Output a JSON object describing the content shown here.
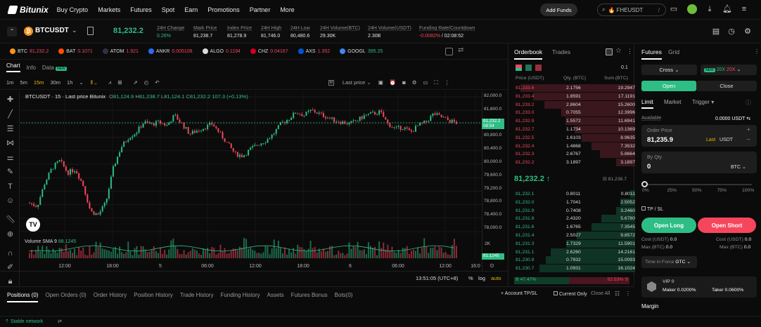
{
  "nav": {
    "brand": "Bitunix",
    "items": [
      "Buy Crypto",
      "Markets",
      "Futures",
      "Spot",
      "Earn",
      "Promotions",
      "Partner",
      "More"
    ],
    "add_funds": "Add Funds",
    "search": "FHEUSDT",
    "search_key": "/"
  },
  "ticker": {
    "symbol": "BTCUSDT",
    "price": "81,232.2",
    "stats": [
      {
        "label": "24H Change",
        "value": "0.26%",
        "color": "#2ebd85"
      },
      {
        "label": "Mark Price",
        "value": "81,238.7",
        "color": ""
      },
      {
        "label": "Index Price",
        "value": "81,278.9",
        "color": ""
      },
      {
        "label": "24H High",
        "value": "81,746.0",
        "color": ""
      },
      {
        "label": "24H Low",
        "value": "80,480.6",
        "color": ""
      },
      {
        "label": "24H Volume(BTC)",
        "value": "29.30K",
        "color": ""
      },
      {
        "label": "24H Volume(USDT)",
        "value": "2.30B",
        "color": ""
      }
    ],
    "funding_label": "Funding Rate/Countdown",
    "funding_rate": "-0.0082%",
    "funding_countdown": "/ 02:08:52"
  },
  "marquee": [
    {
      "sym": "BTC",
      "price": "81,232.2",
      "color": "#f7931a",
      "up": false
    },
    {
      "sym": "BAT",
      "price": "0.1071",
      "color": "#ff5000",
      "up": false
    },
    {
      "sym": "ATOM",
      "price": "1.921",
      "color": "#2e3148",
      "up": false
    },
    {
      "sym": "ANKR",
      "price": "0.005108",
      "color": "#2e6bf6",
      "up": false
    },
    {
      "sym": "ALGO",
      "price": "0.1194",
      "color": "#dddddd",
      "up": false
    },
    {
      "sym": "CHZ",
      "price": "0.04167",
      "color": "#cd0124",
      "up": false
    },
    {
      "sym": "AXS",
      "price": "1.352",
      "color": "#0055d5",
      "up": false
    },
    {
      "sym": "GOOGL",
      "price": "395.25",
      "color": "#4285f4",
      "up": true
    }
  ],
  "chart_tabs": [
    "Chart",
    "Info",
    "Data"
  ],
  "data_badge": "NEW",
  "timeframes": [
    "1m",
    "5m",
    "15m",
    "30m",
    "1h"
  ],
  "active_tf": "15m",
  "price_type": "Last price",
  "chart": {
    "title": "BTCUSDT · 15 · Last price Bitunix",
    "ohlc": {
      "O": "81,124.9",
      "H": "81,238.7",
      "L": "81,124.1",
      "C": "81,232.2",
      "chg": "107.3 (+0.13%)"
    },
    "current_price": "81,232.2",
    "countdown": "08:54",
    "volume_label": "81.1245",
    "vol_sma_label": "Volume SMA 9",
    "vol_sma_value": "88.1245",
    "vol_axis": "2K",
    "y_ticks": [
      "82,000.0",
      "81,600.0",
      "81,200.0",
      "80,800.0",
      "80,400.0",
      "80,000.0",
      "79,600.0",
      "79,200.0",
      "78,800.0",
      "78,400.0",
      "78,000.0"
    ],
    "x_ticks": [
      "12:00",
      "18:00",
      "5",
      "06:00",
      "12:00",
      "18:00",
      "6",
      "06:00",
      "12:00",
      "16:0"
    ],
    "time": "13:51:05 (UTC+8)",
    "pct": "%",
    "log": "log",
    "auto": "auto"
  },
  "chart_data": {
    "type": "candlestick",
    "title": "BTCUSDT · 15 · Last price Bitunix",
    "ylim": [
      78000,
      82000
    ],
    "x": [
      "12:00",
      "18:00",
      "5",
      "06:00",
      "12:00",
      "18:00",
      "6",
      "06:00",
      "12:00"
    ],
    "close_path": [
      78850,
      78750,
      79450,
      79900,
      80100,
      79750,
      79850,
      79400,
      78600,
      78500,
      78850,
      79900,
      80500,
      80800,
      80950,
      81250,
      81180,
      81250,
      81150,
      81450,
      81200,
      80900,
      81000,
      81100,
      81200,
      80900,
      80600,
      80300,
      80250,
      80450,
      80600,
      80700,
      80900,
      81200,
      81350,
      81550,
      81450,
      81600,
      81500,
      81400,
      81300,
      81250,
      81200,
      81300,
      81450,
      81500,
      81550,
      81200,
      81050,
      81100,
      80950,
      81150,
      81250,
      81500,
      81400,
      81300,
      81232
    ]
  },
  "orderbook": {
    "tabs": [
      "Orderbook",
      "Trades"
    ],
    "precision": "0.1",
    "headers": [
      "Price (USDT)",
      "Qty. (BTC)",
      "Sum (BTC)"
    ],
    "asks": [
      [
        "81,233.6",
        "2.1756",
        "19.2947"
      ],
      [
        "81,233.4",
        "1.8591",
        "17.1191"
      ],
      [
        "81,233.2",
        "2.8604",
        "15.2600"
      ],
      [
        "81,233.0",
        "0.7055",
        "12.3996"
      ],
      [
        "81,232.9",
        "1.5572",
        "11.6941"
      ],
      [
        "81,232.7",
        "1.1734",
        "10.1369"
      ],
      [
        "81,232.5",
        "1.6103",
        "8.9635"
      ],
      [
        "81,232.4",
        "1.4868",
        "7.3532"
      ],
      [
        "81,232.3",
        "2.6767",
        "5.8664"
      ],
      [
        "81,232.2",
        "3.1897",
        "3.1897"
      ]
    ],
    "mid": "81,232.2 ↑",
    "mark": "81,238.7",
    "bids": [
      [
        "81,232.1",
        "0.8011",
        "0.8011"
      ],
      [
        "81,232.0",
        "1.7041",
        "2.5052"
      ],
      [
        "81,231.9",
        "0.7408",
        "3.2460"
      ],
      [
        "81,231.8",
        "2.4320",
        "5.6780"
      ],
      [
        "81,231.6",
        "1.6765",
        "7.3545"
      ],
      [
        "81,231.4",
        "2.5027",
        "9.8572"
      ],
      [
        "81,231.3",
        "1.7329",
        "11.5901"
      ],
      [
        "81,231.1",
        "2.6260",
        "14.2161"
      ],
      [
        "81,230.9",
        "0.7932",
        "15.0093"
      ],
      [
        "81,230.7",
        "1.0931",
        "16.1024"
      ]
    ],
    "buy_pct": "47.47%",
    "sell_pct": "52.53%",
    "b": "B",
    "s": "S"
  },
  "trade": {
    "tabs": [
      "Futures",
      "Grid"
    ],
    "margin_mode": "Cross",
    "lev_badge": "NEW",
    "lev_long": "20X",
    "lev_short": "20X",
    "open": "Open",
    "close": "Close",
    "order_types": [
      "Limit",
      "Market",
      "Trigger"
    ],
    "available_label": "Available",
    "available": "0.0000 USDT",
    "price_label": "Order Price",
    "price": "81,235.9",
    "last": "Last",
    "price_unit": "USDT",
    "qty_label": "By Qty",
    "qty": "0",
    "qty_unit": "BTC",
    "slider": [
      "0%",
      "25%",
      "50%",
      "75%",
      "100%"
    ],
    "tpsl": "TP / SL",
    "open_long": "Open Long",
    "open_short": "Open Short",
    "cost_label": "Cost (USDT)",
    "cost_l": "0.0",
    "cost_s": "0.0",
    "max_label": "Max (BTC)",
    "max_l": "0.0",
    "max_s": "0.0",
    "tif_label": "Time in Force",
    "tif": "GTC",
    "vip": "VIP 0",
    "maker": "Maker 0.0200%",
    "taker": "Taker 0.0600%",
    "margin": "Margin"
  },
  "bottom_tabs": [
    "Positions (0)",
    "Open Orders (0)",
    "Order History",
    "Position History",
    "Trade History",
    "Funding History",
    "Assets",
    "Futures Bonus",
    "Bots(0)"
  ],
  "bottom_right": {
    "account_tpsl": "Account TP/SL",
    "current_only": "Current Only",
    "close_all": "Close All"
  },
  "status": {
    "network": "Stable network"
  }
}
